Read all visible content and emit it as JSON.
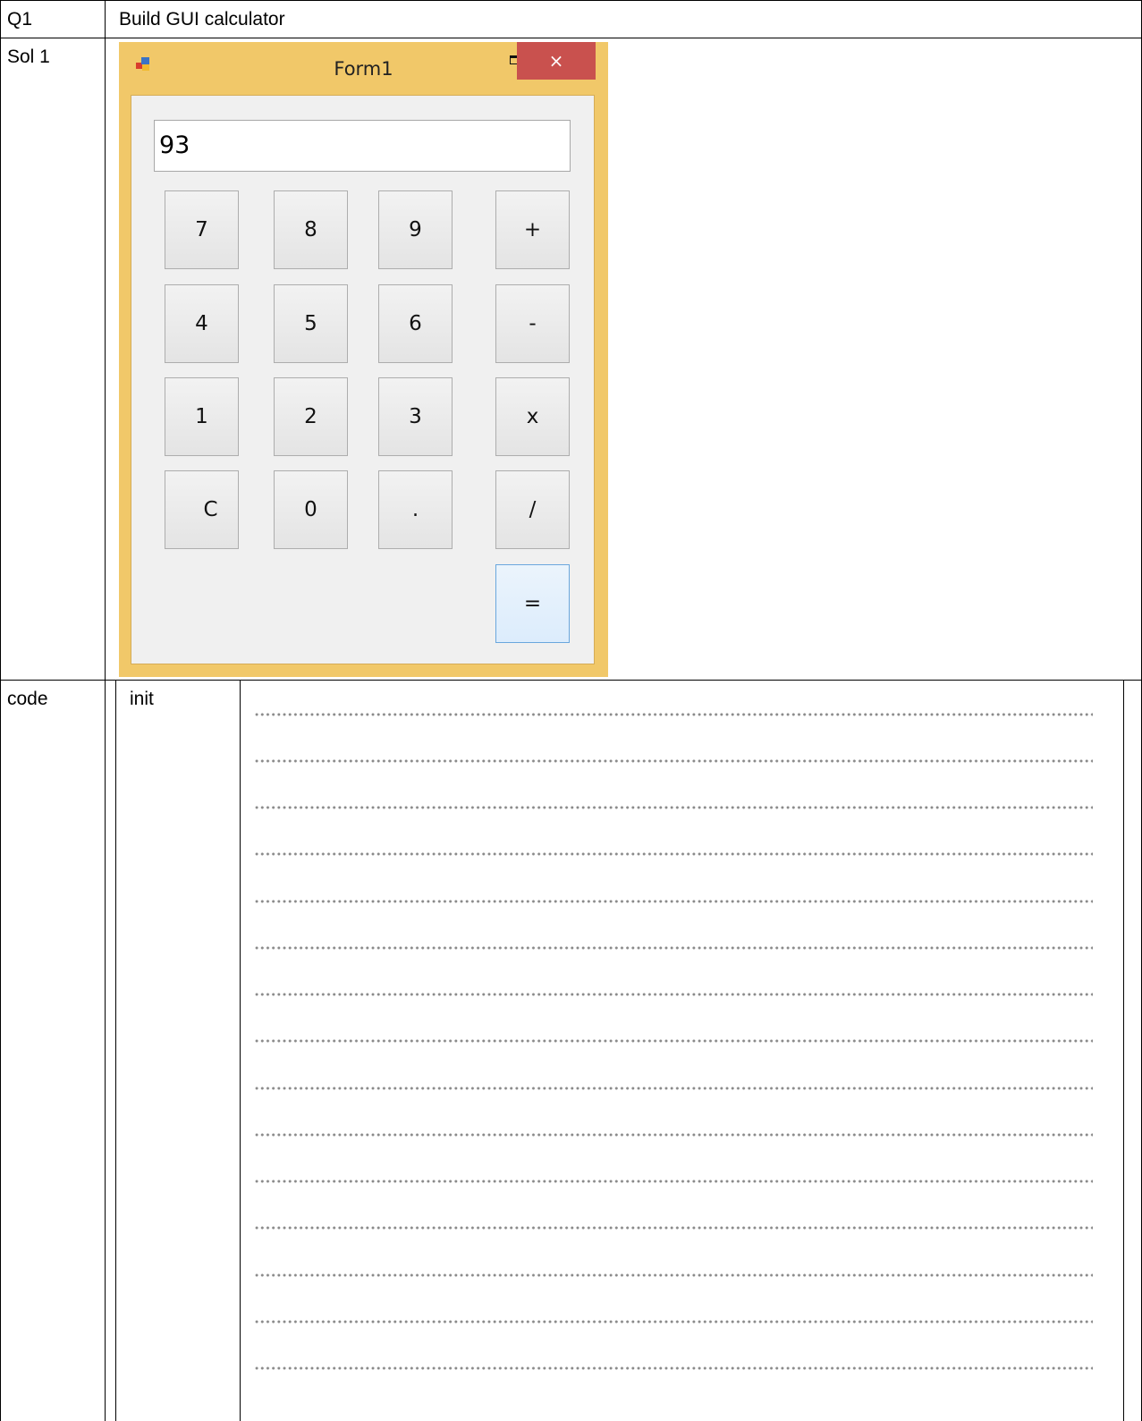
{
  "table": {
    "row1": {
      "label": "Q1",
      "content": "Build GUI calculator"
    },
    "row2": {
      "label": "Sol 1"
    },
    "row3": {
      "label": "code",
      "sub_label": "init"
    }
  },
  "calculator": {
    "window_title": "Form1",
    "close_glyph": "×",
    "display_value": "93",
    "keys": [
      [
        "7",
        "8",
        "9",
        "+"
      ],
      [
        "4",
        "5",
        "6",
        "-"
      ],
      [
        "1",
        "2",
        "3",
        "x"
      ],
      [
        "C",
        "0",
        ".",
        "/"
      ],
      [
        "="
      ]
    ]
  },
  "icons": [
    "form-app-icon",
    "minimize-icon",
    "maximize-icon",
    "close-icon"
  ],
  "colors": {
    "window_frame": "#f1c869",
    "close_button": "#c9514e",
    "client_area": "#f0f0f0",
    "equals_button": "#dcecfc"
  },
  "answer_lines": 15
}
